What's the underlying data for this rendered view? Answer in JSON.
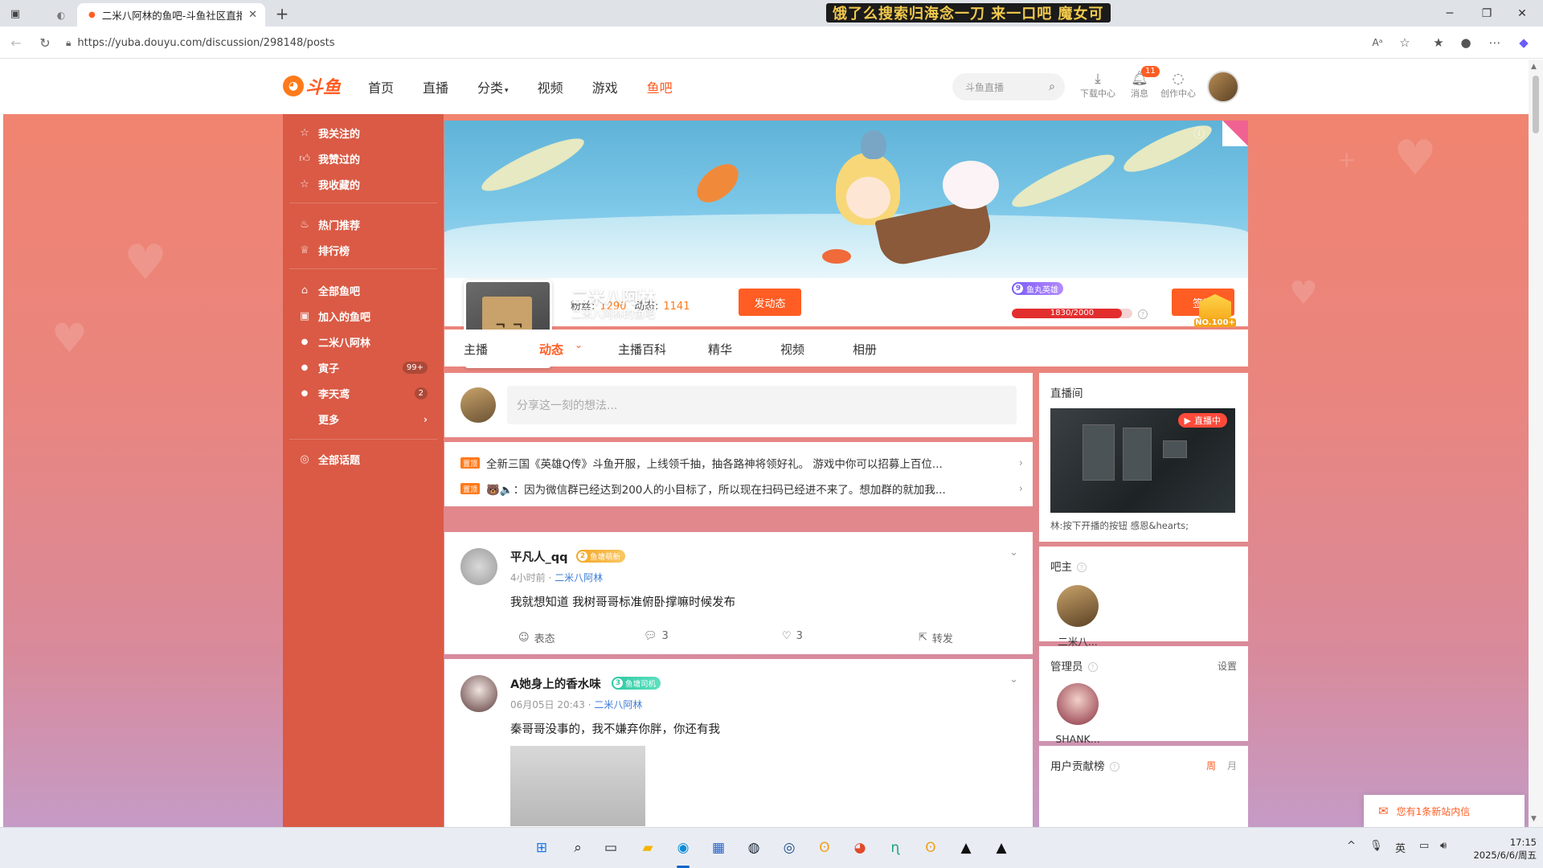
{
  "browser": {
    "tab_title": "二米八阿林的鱼吧-斗鱼社区直播",
    "url": "https://yuba.douyu.com/discussion/298148/posts",
    "lyrics": "饿了么搜索归海念一刀 来一口吧 魔女可"
  },
  "header": {
    "logo_text": "斗鱼",
    "nav": [
      {
        "label": "首页",
        "active": false
      },
      {
        "label": "直播",
        "active": false
      },
      {
        "label": "分类",
        "active": false
      },
      {
        "label": "视频",
        "active": false
      },
      {
        "label": "游戏",
        "active": false
      },
      {
        "label": "鱼吧",
        "active": true
      }
    ],
    "search_placeholder": "斗鱼直播",
    "tools": [
      {
        "label": "下载中心",
        "icon": "download-icon"
      },
      {
        "label": "消息",
        "icon": "bell-icon",
        "badge": "11"
      },
      {
        "label": "创作中心",
        "icon": "bulb-icon"
      }
    ]
  },
  "sidebar": {
    "group1": [
      {
        "label": "我关注的",
        "icon": "star-icon"
      },
      {
        "label": "我赞过的",
        "icon": "thumb-icon"
      },
      {
        "label": "我收藏的",
        "icon": "bookmark-icon"
      }
    ],
    "group2": [
      {
        "label": "热门推荐",
        "icon": "fire-icon"
      },
      {
        "label": "排行榜",
        "icon": "trophy-icon"
      }
    ],
    "group3": [
      {
        "label": "全部鱼吧",
        "icon": "home-icon"
      },
      {
        "label": "加入的鱼吧",
        "icon": "joined-icon"
      }
    ],
    "bars": [
      {
        "label": "二米八阿林",
        "badge": ""
      },
      {
        "label": "寅子",
        "badge": "99+"
      },
      {
        "label": "李天鸢",
        "badge": "2"
      }
    ],
    "more_label": "更多",
    "topics_label": "全部话题"
  },
  "profile": {
    "name": "二米八阿林",
    "bar_name": "二米八阿林的鱼吧",
    "fans_label": "粉丝:",
    "fans": "1290",
    "posts_label": "动态:",
    "posts": "1141",
    "post_button": "发动态",
    "rank": "NO.100+",
    "fan_level": "9",
    "fan_badge": "鱼丸英雄",
    "progress_text": "1830/2000",
    "progress_fraction": 0.915,
    "sign_button": "签到"
  },
  "tabs": [
    {
      "label": "主播",
      "active": false
    },
    {
      "label": "动态",
      "active": true
    },
    {
      "label": "主播百科",
      "active": false
    },
    {
      "label": "精华",
      "active": false
    },
    {
      "label": "视频",
      "active": false
    },
    {
      "label": "相册",
      "active": false
    }
  ],
  "composer": {
    "placeholder": "分享这一刻的想法..."
  },
  "notices": [
    {
      "tag": "置顶",
      "text": "全新三国《英雄Q传》斗鱼开服，上线领千抽，抽各路神将领好礼。 游戏中你可以招募上百位..."
    },
    {
      "tag": "置顶",
      "text": "🐻🔈：因为微信群已经达到200人的小目标了，所以现在扫码已经进不来了。想加群的就加我..."
    }
  ],
  "posts": [
    {
      "user": "平凡人_qq",
      "level": "2",
      "badge": "鱼塘萌新",
      "time": "4小时前 · ",
      "source": "二米八阿林",
      "body": "我就想知道 我树哥哥标准俯卧撑嘛时候发布",
      "react_label": "表态",
      "comments": "3",
      "likes": "3",
      "share_label": "转发"
    },
    {
      "user": "A她身上的香水味",
      "level": "3",
      "badge": "鱼塘司机",
      "time": "06月05日 20:43 · ",
      "source": "二米八阿林",
      "body": "秦哥哥没事的，我不嫌弃你胖，你还有我"
    }
  ],
  "right": {
    "live_title": "直播间",
    "live_badge": "直播中",
    "live_caption": "林:按下开播的按钮 感恩&hearts;",
    "owner_title": "吧主",
    "owner_name": "二米八...",
    "admin_title": "管理员",
    "admin_settings": "设置",
    "admin_name": "SHANK...",
    "contrib_title": "用户贡献榜",
    "contrib_tabs": [
      "周",
      "月"
    ]
  },
  "toast": {
    "text": "您有1条新站内信"
  },
  "taskbar": {
    "ime": "英",
    "time": "17:15",
    "date": "2025/6/6/周五"
  },
  "colors": {
    "brand": "#ff5d23",
    "sidebar": "#da5a45",
    "link": "#3b7bd6"
  }
}
